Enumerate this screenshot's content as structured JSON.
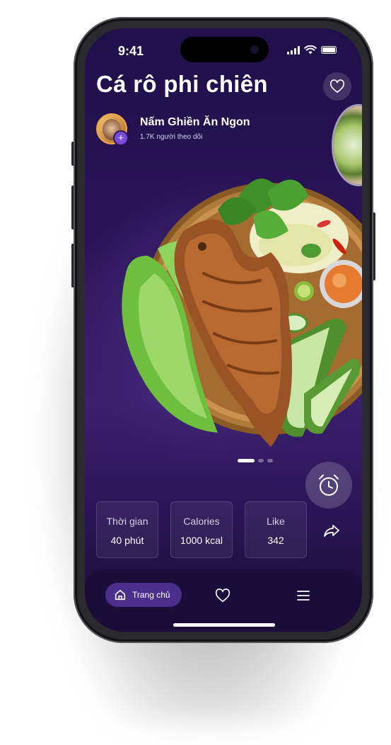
{
  "status_bar": {
    "time": "9:41"
  },
  "recipe": {
    "title": "Cá rô phi chiên",
    "author": {
      "name": "Nấm Ghiền Ăn Ngon",
      "followers": "1.7K người theo dõi"
    }
  },
  "carousel": {
    "pages": 3,
    "active_page": 1
  },
  "stats": [
    {
      "label": "Thời gian",
      "value": "40 phút"
    },
    {
      "label": "Calories",
      "value": "1000 kcal"
    },
    {
      "label": "Like",
      "value": "342"
    }
  ],
  "nav": {
    "home_label": "Trang chủ"
  },
  "icons": {
    "favorite": "heart-icon",
    "timer": "alarm-clock-icon",
    "share": "share-icon",
    "home": "home-icon",
    "menu": "hamburger-menu-icon"
  },
  "colors": {
    "accent": "#4a2f8c",
    "background": "#2a1557",
    "text": "#ffffff"
  }
}
